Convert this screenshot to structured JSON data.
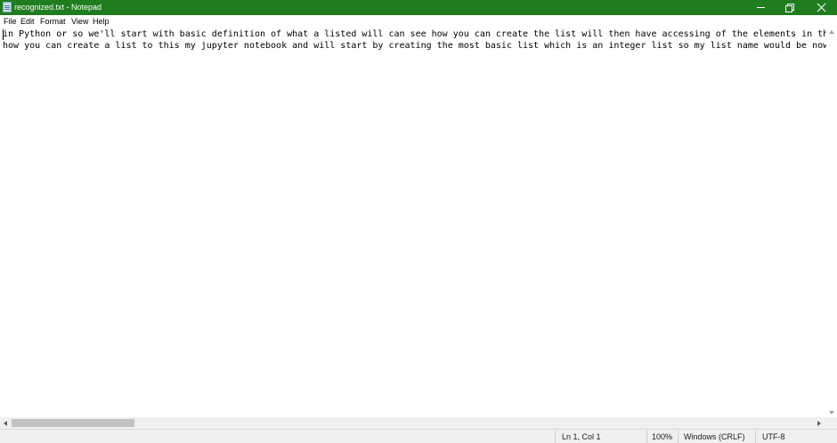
{
  "window": {
    "title": "recognized.txt - Notepad",
    "icon": "notepad-icon",
    "titlebar_color": "#1f7d1f"
  },
  "menu": {
    "items": [
      "File",
      "Edit",
      "Format",
      "View",
      "Help"
    ]
  },
  "editor": {
    "lines": [
      "in Python or so we'll start with basic definition of what a listed will can see how you can create the list will then have accessing of the elements in the l",
      "how you can create a list to this my jupyter notebook and will start by creating the most basic list which is an integer list so my list name would be now"
    ]
  },
  "status": {
    "position": "Ln 1, Col 1",
    "zoom": "100%",
    "line_ending": "Windows (CRLF)",
    "encoding": "UTF-8"
  }
}
